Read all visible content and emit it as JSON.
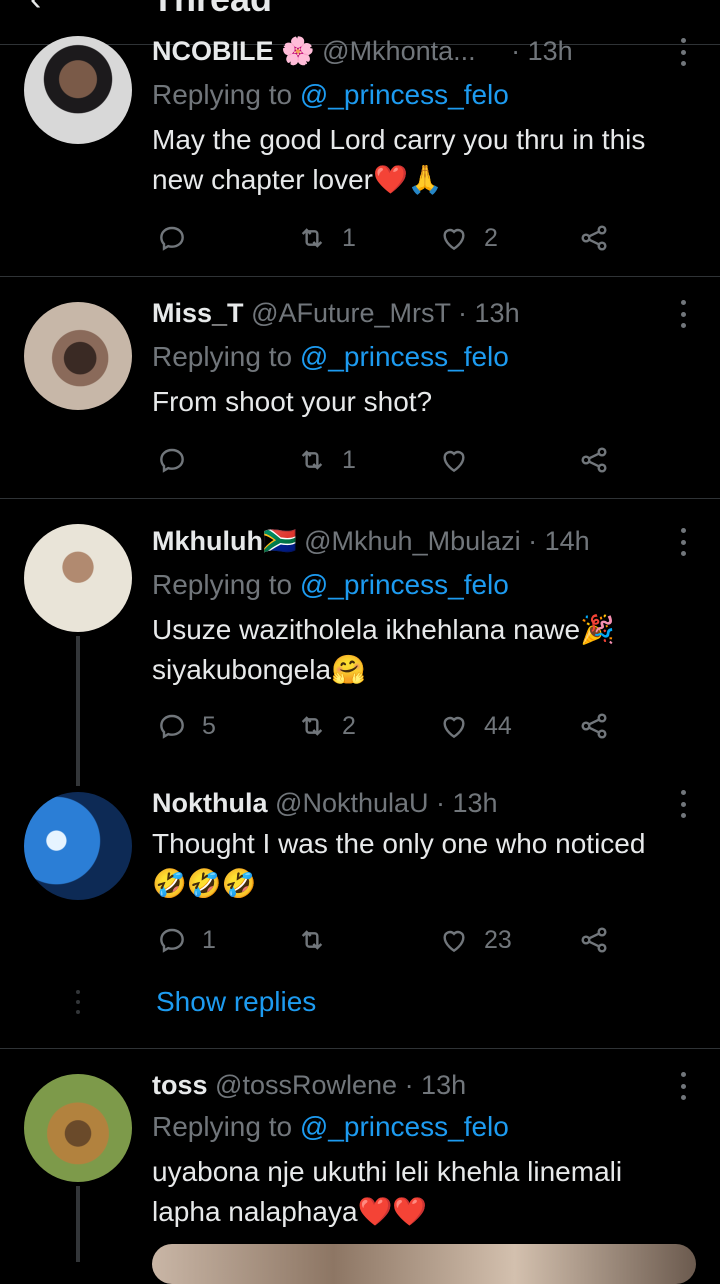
{
  "header": {
    "back_icon": "arrow-left-icon",
    "title": "Thread"
  },
  "tweets": [
    {
      "name": "NCOBILE",
      "name_emoji": "🌸",
      "handle": "@Mkhonta...",
      "time": "· 13h",
      "reply_label": "Replying to",
      "reply_mention": "@_princess_felo",
      "text_line1": "May the good Lord carry you thru in this",
      "text_line2": "new chapter lover",
      "text_emoji": "❤️🙏",
      "replies": "",
      "retweets": "1",
      "likes": "2"
    },
    {
      "name": "Miss_T",
      "handle": "@AFuture_MrsT",
      "time": "· 13h",
      "reply_label": "Replying to",
      "reply_mention": "@_princess_felo",
      "text_line1": "From shoot your shot?",
      "replies": "",
      "retweets": "1",
      "likes": ""
    },
    {
      "name": "Mkhuluh",
      "name_emoji": "🇿🇦",
      "handle": "@Mkhuh_Mbulazi",
      "time": "· 14h",
      "reply_label": "Replying to",
      "reply_mention": "@_princess_felo",
      "text_line1": "Usuze wazitholela ikhehlana nawe",
      "text_line1_emoji": "🎉",
      "text_line2": "siyakubongela",
      "text_line2_emoji": "🤗",
      "replies": "5",
      "retweets": "2",
      "likes": "44"
    },
    {
      "name": "Nokthula",
      "handle": "@NokthulaU",
      "time": "· 13h",
      "text_line1": "Thought I was the only one who noticed",
      "text_line2_emoji": "🤣🤣🤣",
      "replies": "1",
      "retweets": "",
      "likes": "23"
    },
    {
      "name": "toss",
      "handle": "@tossRowlene",
      "time": "· 13h",
      "reply_label": "Replying to",
      "reply_mention": "@_princess_felo",
      "text_line1": "uyabona nje ukuthi leli khehla linemali",
      "text_line2": "lapha nalaphaya",
      "text_emoji": "❤️❤️"
    }
  ],
  "show_replies": "Show replies",
  "colors": {
    "background": "#000000",
    "text": "#e7e9ea",
    "muted": "#71767b",
    "accent": "#1d9bf0",
    "divider": "#2f3336"
  },
  "icons": [
    "reply-icon",
    "retweet-icon",
    "like-icon",
    "share-icon",
    "more-icon"
  ]
}
